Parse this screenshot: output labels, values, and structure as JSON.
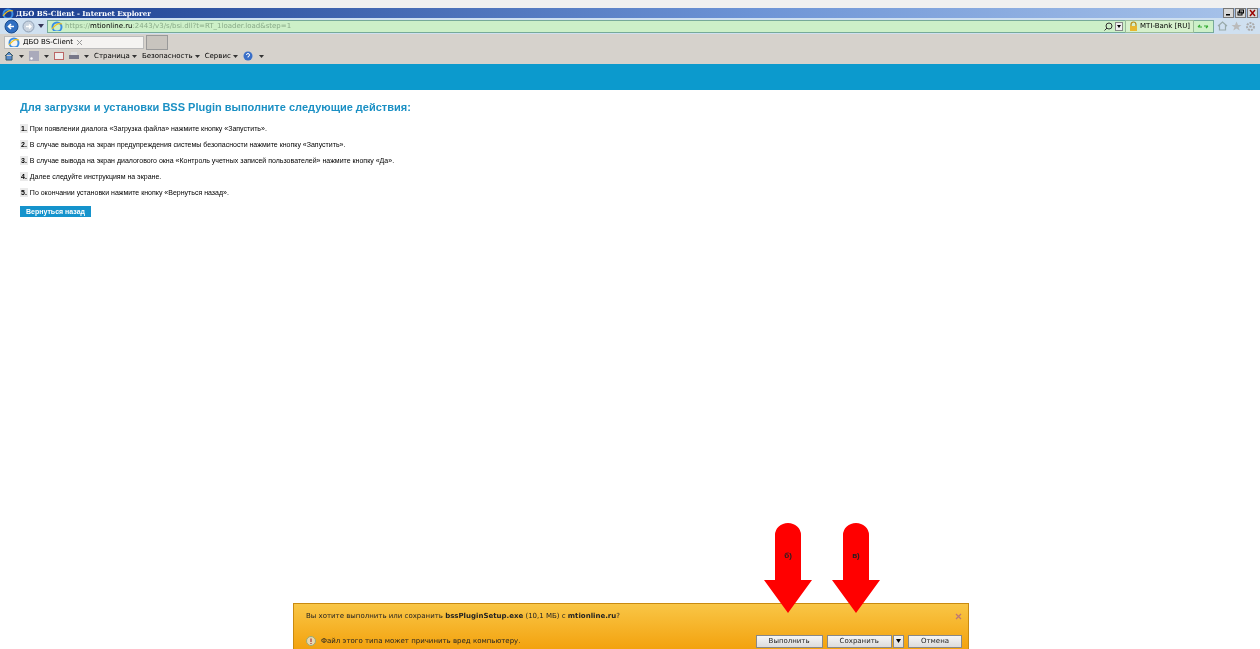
{
  "window": {
    "title": "ДБО BS-Client - Internet Explorer"
  },
  "address_bar": {
    "scheme": "https://",
    "host": "mtionline.ru",
    "path": ":2443/v3/s/bsi.dll?t=RT_1loader.load&step=1",
    "site_identity": "MTI-Bank [RU]"
  },
  "tabs": [
    {
      "label": "ДБО BS-Client",
      "selected": true
    }
  ],
  "command_bar": [
    {
      "label": "Страница"
    },
    {
      "label": "Безопасность"
    },
    {
      "label": "Сервис"
    }
  ],
  "page": {
    "heading": "Для загрузки и установки BSS Plugin выполните следующие действия:",
    "steps": [
      {
        "number": "1.",
        "text": "При появлении диалога «Загрузка файла» нажмите кнопку «Запустить»."
      },
      {
        "number": "2.",
        "text": "В случае вывода на экран предупреждения системы безопасности нажмите кнопку «Запустить»."
      },
      {
        "number": "3.",
        "text": "В случае вывода на экран диалогового окна «Контроль учетных записей пользователей» нажмите кнопку «Да»."
      },
      {
        "number": "4.",
        "text": "Далее следуйте инструкциям на экране."
      },
      {
        "number": "5.",
        "text": "По окончании установки нажмите кнопку «Вернуться назад»."
      }
    ],
    "back_button": "Вернуться назад"
  },
  "annotations": [
    {
      "label": "б)"
    },
    {
      "label": "в)"
    }
  ],
  "download_bar": {
    "message": "Вы хотите выполнить или сохранить **bssPluginSetup.exe** (10,1 МБ) с **mtionline.ru**?",
    "warning": "Файл этого типа может причинить вред компьютеру.",
    "buttons": [
      {
        "label": "Выполнить",
        "kind": "plain"
      },
      {
        "label": "Сохранить",
        "kind": "split"
      },
      {
        "label": "Отмена",
        "kind": "plain"
      }
    ]
  }
}
